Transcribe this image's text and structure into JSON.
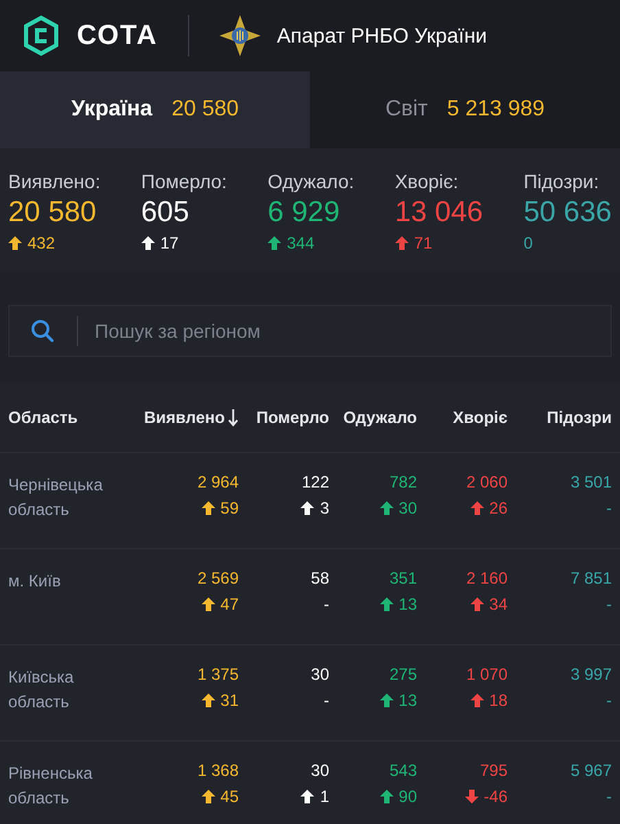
{
  "header": {
    "brand": "СОТА",
    "organization": "Апарат РНБО України"
  },
  "tabs": [
    {
      "label": "Україна",
      "value": "20 580",
      "selected": true
    },
    {
      "label": "Світ",
      "value": "5 213 989",
      "selected": false
    }
  ],
  "stats": [
    {
      "label": "Виявлено:",
      "value": "20 580",
      "delta": "432",
      "increase": true,
      "decrease": false,
      "color": "#f5b82e"
    },
    {
      "label": "Померло:",
      "value": "605",
      "delta": "17",
      "increase": true,
      "decrease": false,
      "color": "#ffffff"
    },
    {
      "label": "Одужало:",
      "value": "6 929",
      "delta": "344",
      "increase": true,
      "decrease": false,
      "color": "#1fb574"
    },
    {
      "label": "Хворіє:",
      "value": "13 046",
      "delta": "71",
      "increase": true,
      "decrease": false,
      "color": "#ef4444"
    },
    {
      "label": "Підозри:",
      "value": "50 636",
      "delta": "0",
      "increase": false,
      "decrease": false,
      "color": "#3aa6a8"
    }
  ],
  "search": {
    "placeholder": "Пошук за регіоном"
  },
  "table": {
    "columns": [
      {
        "label": "Область",
        "kind": "region",
        "sorted": false
      },
      {
        "label": "Виявлено",
        "kind": "confirmed",
        "sorted": true
      },
      {
        "label": "Померло",
        "kind": "deaths",
        "sorted": false
      },
      {
        "label": "Одужало",
        "kind": "recovered",
        "sorted": false
      },
      {
        "label": "Хворіє",
        "kind": "sick",
        "sorted": false
      },
      {
        "label": "Підозри",
        "kind": "suspected",
        "sorted": false
      }
    ],
    "rows": [
      {
        "cells": [
          {
            "value": "Чернівецька область"
          },
          {
            "value": "2 964",
            "delta": "59",
            "increase": true,
            "decrease": false
          },
          {
            "value": "122",
            "delta": "3",
            "increase": true,
            "decrease": false
          },
          {
            "value": "782",
            "delta": "30",
            "increase": true,
            "decrease": false
          },
          {
            "value": "2 060",
            "delta": "26",
            "increase": true,
            "decrease": false
          },
          {
            "value": "3 501",
            "delta": "-",
            "increase": false,
            "decrease": false
          }
        ]
      },
      {
        "cells": [
          {
            "value": "м. Київ"
          },
          {
            "value": "2 569",
            "delta": "47",
            "increase": true,
            "decrease": false
          },
          {
            "value": "58",
            "delta": "-",
            "increase": false,
            "decrease": false
          },
          {
            "value": "351",
            "delta": "13",
            "increase": true,
            "decrease": false
          },
          {
            "value": "2 160",
            "delta": "34",
            "increase": true,
            "decrease": false
          },
          {
            "value": "7 851",
            "delta": "-",
            "increase": false,
            "decrease": false
          }
        ]
      },
      {
        "cells": [
          {
            "value": "Київська область"
          },
          {
            "value": "1 375",
            "delta": "31",
            "increase": true,
            "decrease": false
          },
          {
            "value": "30",
            "delta": "-",
            "increase": false,
            "decrease": false
          },
          {
            "value": "275",
            "delta": "13",
            "increase": true,
            "decrease": false
          },
          {
            "value": "1 070",
            "delta": "18",
            "increase": true,
            "decrease": false
          },
          {
            "value": "3 997",
            "delta": "-",
            "increase": false,
            "decrease": false
          }
        ]
      },
      {
        "cells": [
          {
            "value": "Рівненська область"
          },
          {
            "value": "1 368",
            "delta": "45",
            "increase": true,
            "decrease": false
          },
          {
            "value": "30",
            "delta": "1",
            "increase": true,
            "decrease": false
          },
          {
            "value": "543",
            "delta": "90",
            "increase": true,
            "decrease": false
          },
          {
            "value": "795",
            "delta": "-46",
            "increase": false,
            "decrease": true
          },
          {
            "value": "5 967",
            "delta": "-",
            "increase": false,
            "decrease": false
          }
        ]
      }
    ]
  }
}
